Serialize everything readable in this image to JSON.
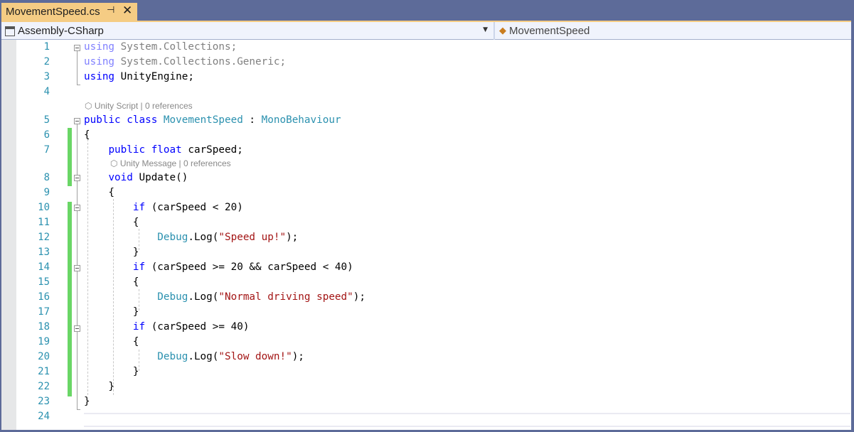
{
  "tab": {
    "title": "MovementSpeed.cs",
    "pin_icon": "pin-icon",
    "close_icon": "close-icon"
  },
  "navbar": {
    "project": "Assembly-CSharp",
    "project_icon": "csharp-project-icon",
    "class": "MovementSpeed",
    "class_icon": "class-icon"
  },
  "lenses": {
    "class_lens": "Unity Script | 0 references",
    "method_lens": "Unity Message | 0 references"
  },
  "lines": [
    {
      "n": "1",
      "tokens": [
        [
          "kw-dim",
          "using"
        ],
        [
          "dim",
          " System.Collections;"
        ]
      ]
    },
    {
      "n": "2",
      "tokens": [
        [
          "kw-dim",
          "using"
        ],
        [
          "dim",
          " System.Collections.Generic;"
        ]
      ]
    },
    {
      "n": "3",
      "tokens": [
        [
          "kw",
          "using"
        ],
        [
          "",
          "  UnityEngine;"
        ]
      ]
    },
    {
      "n": "4",
      "tokens": []
    },
    {
      "n": "5",
      "tokens": [
        [
          "kw",
          "public"
        ],
        [
          "",
          " "
        ],
        [
          "kw",
          "class"
        ],
        [
          "",
          " "
        ],
        [
          "type",
          "MovementSpeed"
        ],
        [
          "",
          " : "
        ],
        [
          "type",
          "MonoBehaviour"
        ]
      ]
    },
    {
      "n": "6",
      "tokens": [
        [
          "",
          "{"
        ]
      ]
    },
    {
      "n": "7",
      "tokens": [
        [
          "",
          "    "
        ],
        [
          "kw",
          "public"
        ],
        [
          "",
          " "
        ],
        [
          "kw",
          "float"
        ],
        [
          "",
          " carSpeed;"
        ]
      ]
    },
    {
      "n": "8",
      "tokens": [
        [
          "",
          "    "
        ],
        [
          "kw",
          "void"
        ],
        [
          "",
          " Update()"
        ]
      ]
    },
    {
      "n": "9",
      "tokens": [
        [
          "",
          "    {"
        ]
      ]
    },
    {
      "n": "10",
      "tokens": [
        [
          "",
          "        "
        ],
        [
          "kw",
          "if"
        ],
        [
          "",
          " (carSpeed < 20)"
        ]
      ]
    },
    {
      "n": "11",
      "tokens": [
        [
          "",
          "        {"
        ]
      ]
    },
    {
      "n": "12",
      "tokens": [
        [
          "",
          "            "
        ],
        [
          "type",
          "Debug"
        ],
        [
          "",
          ".Log("
        ],
        [
          "str",
          "\"Speed up!\""
        ],
        [
          "",
          ");"
        ]
      ]
    },
    {
      "n": "13",
      "tokens": [
        [
          "",
          "        }"
        ]
      ]
    },
    {
      "n": "14",
      "tokens": [
        [
          "",
          "        "
        ],
        [
          "kw",
          "if"
        ],
        [
          "",
          " (carSpeed >= 20 && carSpeed < 40)"
        ]
      ]
    },
    {
      "n": "15",
      "tokens": [
        [
          "",
          "        {"
        ]
      ]
    },
    {
      "n": "16",
      "tokens": [
        [
          "",
          "            "
        ],
        [
          "type",
          "Debug"
        ],
        [
          "",
          ".Log("
        ],
        [
          "str",
          "\"Normal driving speed\""
        ],
        [
          "",
          ");"
        ]
      ]
    },
    {
      "n": "17",
      "tokens": [
        [
          "",
          "        }"
        ]
      ]
    },
    {
      "n": "18",
      "tokens": [
        [
          "",
          "        "
        ],
        [
          "kw",
          "if"
        ],
        [
          "",
          " (carSpeed >= 40)"
        ]
      ]
    },
    {
      "n": "19",
      "tokens": [
        [
          "",
          "        {"
        ]
      ]
    },
    {
      "n": "20",
      "tokens": [
        [
          "",
          "            "
        ],
        [
          "type",
          "Debug"
        ],
        [
          "",
          ".Log("
        ],
        [
          "str",
          "\"Slow down!\""
        ],
        [
          "",
          ");"
        ]
      ]
    },
    {
      "n": "21",
      "tokens": [
        [
          "",
          "        }"
        ]
      ]
    },
    {
      "n": "22",
      "tokens": [
        [
          "",
          "    }"
        ]
      ]
    },
    {
      "n": "23",
      "tokens": [
        [
          "",
          "}"
        ]
      ]
    },
    {
      "n": "24",
      "tokens": []
    }
  ]
}
